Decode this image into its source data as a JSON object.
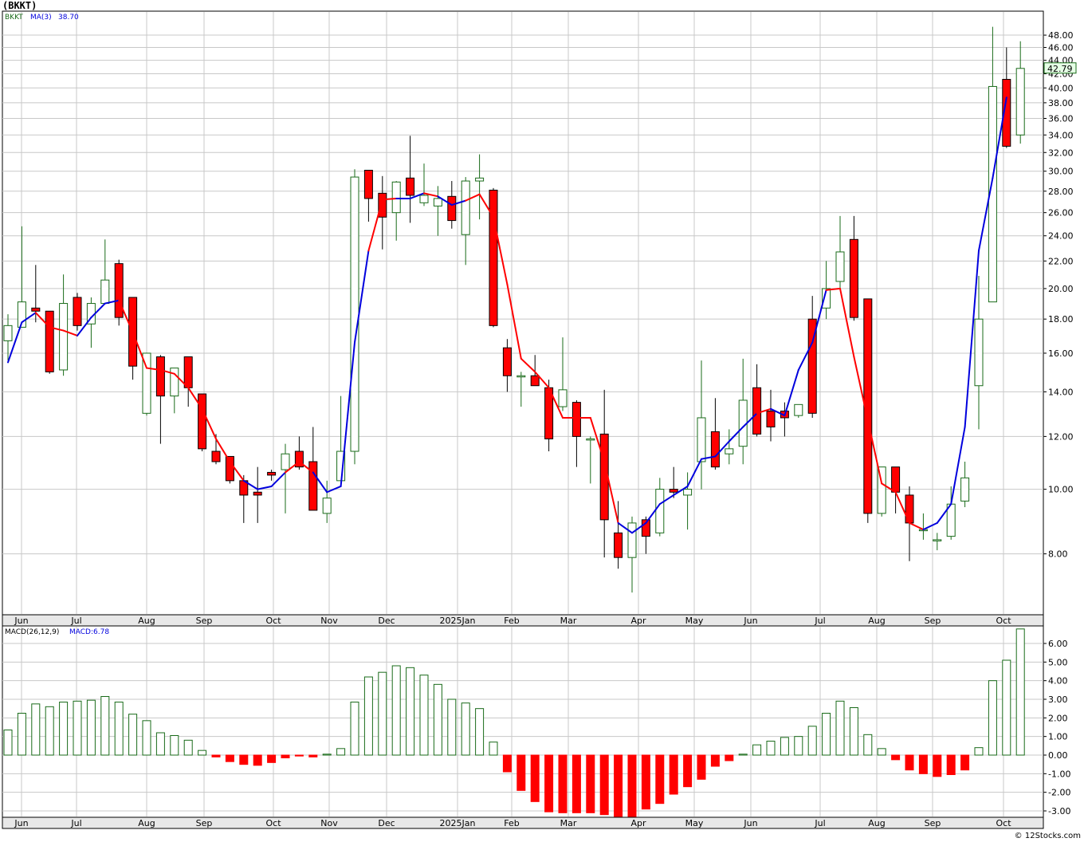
{
  "window": {
    "title": "(BKKT)",
    "footer": "© 12Stocks.com"
  },
  "price_panel": {
    "symbol_label": "BKKT",
    "ma_label": "MA(3)",
    "ma_value": "38.70",
    "last_price": "42.79"
  },
  "macd_panel": {
    "label": "MACD(26,12,9)",
    "value_label": "MACD:6.78"
  },
  "colors": {
    "up_candle": "#1a6b1a",
    "down_candle": "#ff0000",
    "ma_up": "#0000dd",
    "ma_down": "#ff0000",
    "grid": "#c8c8c8",
    "last_price_box": "#e6ffe6"
  },
  "chart_data": [
    {
      "type": "candlestick",
      "scale": "log",
      "ylim": [
        6.5,
        52
      ],
      "y_ticks": [
        "8.00",
        "10.00",
        "12.00",
        "14.00",
        "16.00",
        "18.00",
        "20.00",
        "22.00",
        "24.00",
        "26.00",
        "28.00",
        "30.00",
        "32.00",
        "34.00",
        "36.00",
        "38.00",
        "40.00",
        "42.00",
        "44.00",
        "46.00",
        "48.00"
      ],
      "x_labels": [
        "Jun",
        "Jul",
        "Aug",
        "Sep",
        "Oct",
        "Nov",
        "Dec",
        "2025Jan",
        "Feb",
        "Mar",
        "Apr",
        "May",
        "Jun",
        "Jul",
        "Aug",
        "Sep",
        "Oct"
      ],
      "ohlc": [
        [
          16.7,
          18.3,
          15.6,
          17.6
        ],
        [
          17.5,
          24.8,
          17.5,
          19.1
        ],
        [
          18.7,
          21.7,
          17.8,
          18.5
        ],
        [
          18.5,
          18.5,
          14.9,
          15.0
        ],
        [
          15.1,
          21.0,
          14.8,
          19.0
        ],
        [
          19.4,
          19.7,
          17.3,
          17.6
        ],
        [
          17.7,
          19.4,
          16.3,
          19.0
        ],
        [
          19.0,
          23.7,
          19.0,
          20.6
        ],
        [
          21.8,
          22.1,
          17.6,
          18.1
        ],
        [
          19.4,
          19.4,
          14.6,
          15.3
        ],
        [
          13.0,
          16.0,
          12.9,
          16.0
        ],
        [
          15.8,
          15.9,
          11.7,
          13.8
        ],
        [
          13.8,
          15.2,
          13.0,
          15.2
        ],
        [
          15.8,
          15.8,
          13.3,
          14.2
        ],
        [
          13.9,
          13.9,
          11.4,
          11.5
        ],
        [
          11.4,
          12.1,
          10.9,
          11.0
        ],
        [
          11.2,
          11.2,
          10.2,
          10.3
        ],
        [
          10.3,
          10.5,
          8.9,
          9.8
        ],
        [
          9.9,
          10.8,
          8.9,
          9.8
        ],
        [
          10.6,
          10.7,
          10.3,
          10.5
        ],
        [
          10.7,
          11.7,
          9.2,
          11.3
        ],
        [
          11.4,
          12.0,
          10.7,
          10.8
        ],
        [
          11.0,
          12.4,
          9.3,
          9.3
        ],
        [
          9.2,
          10.3,
          8.9,
          9.7
        ],
        [
          10.3,
          13.8,
          10.3,
          11.4
        ],
        [
          11.4,
          30.2,
          10.9,
          29.4
        ],
        [
          30.1,
          30.1,
          25.2,
          27.3
        ],
        [
          27.8,
          29.5,
          22.9,
          25.6
        ],
        [
          26.0,
          29.0,
          23.6,
          28.9
        ],
        [
          29.3,
          33.9,
          25.1,
          27.6
        ],
        [
          26.9,
          30.8,
          26.6,
          27.6
        ],
        [
          26.6,
          28.5,
          24.0,
          27.3
        ],
        [
          27.5,
          29.0,
          24.6,
          25.3
        ],
        [
          24.1,
          29.4,
          21.7,
          29.0
        ],
        [
          29.0,
          31.8,
          25.4,
          29.3
        ],
        [
          28.1,
          28.3,
          17.5,
          17.6
        ],
        [
          16.3,
          16.8,
          14.0,
          14.8
        ],
        [
          14.8,
          15.0,
          13.3,
          14.8
        ],
        [
          14.8,
          15.9,
          14.6,
          14.3
        ],
        [
          14.2,
          14.6,
          11.4,
          11.9
        ],
        [
          13.3,
          16.9,
          13.1,
          14.1
        ],
        [
          13.5,
          13.6,
          10.8,
          12.0
        ],
        [
          11.9,
          12.0,
          10.2,
          11.9
        ],
        [
          12.1,
          14.1,
          7.9,
          9.0
        ],
        [
          8.6,
          9.6,
          7.6,
          7.9
        ],
        [
          7.9,
          9.1,
          7.0,
          8.9
        ],
        [
          9.0,
          9.1,
          8.0,
          8.5
        ],
        [
          8.6,
          10.4,
          8.5,
          10.0
        ],
        [
          10.0,
          10.8,
          9.7,
          9.9
        ],
        [
          9.8,
          10.6,
          8.7,
          10.0
        ],
        [
          11.0,
          15.6,
          10.0,
          12.8
        ],
        [
          12.2,
          13.7,
          10.7,
          10.8
        ],
        [
          11.3,
          12.3,
          10.9,
          11.5
        ],
        [
          11.6,
          15.7,
          10.9,
          13.6
        ],
        [
          14.2,
          15.4,
          12.0,
          12.1
        ],
        [
          13.1,
          14.1,
          11.8,
          12.4
        ],
        [
          13.1,
          13.5,
          12.0,
          12.8
        ],
        [
          12.9,
          13.4,
          12.8,
          13.4
        ],
        [
          18.0,
          19.5,
          12.8,
          13.0
        ],
        [
          18.7,
          22.0,
          18.0,
          20.0
        ],
        [
          20.5,
          25.7,
          19.9,
          22.7
        ],
        [
          23.7,
          25.7,
          17.9,
          18.1
        ],
        [
          19.3,
          19.3,
          8.9,
          9.2
        ],
        [
          9.2,
          10.5,
          9.1,
          10.8
        ],
        [
          10.8,
          10.8,
          9.2,
          9.9
        ],
        [
          9.8,
          10.1,
          7.8,
          8.9
        ],
        [
          8.7,
          9.2,
          8.4,
          8.7
        ],
        [
          8.4,
          8.6,
          8.1,
          8.4
        ],
        [
          8.5,
          10.1,
          8.4,
          9.5
        ],
        [
          9.6,
          11.0,
          9.4,
          10.4
        ],
        [
          14.3,
          20.9,
          12.3,
          18.0
        ],
        [
          19.1,
          49.4,
          19.1,
          40.2
        ],
        [
          41.2,
          46.0,
          32.5,
          32.7
        ],
        [
          34.0,
          47.0,
          33.0,
          42.79
        ]
      ],
      "ma3": [
        15.5,
        17.8,
        18.4,
        17.5,
        17.3,
        17.0,
        18.1,
        19.0,
        19.2,
        17.2,
        15.2,
        15.1,
        14.9,
        14.2,
        13.2,
        11.9,
        11.0,
        10.3,
        10.0,
        10.1,
        10.6,
        11.0,
        10.6,
        9.9,
        10.1,
        16.6,
        22.8,
        27.2,
        27.3,
        27.3,
        27.8,
        27.5,
        26.7,
        27.1,
        27.7,
        25.6,
        20.3,
        15.7,
        15.0,
        14.2,
        12.8,
        12.8,
        12.8,
        11.0,
        8.9,
        8.6,
        8.9,
        9.5,
        9.8,
        10.1,
        11.1,
        11.2,
        11.8,
        12.4,
        13.0,
        13.2,
        12.9,
        15.1,
        16.6,
        19.9,
        20.0,
        15.8,
        12.7,
        10.2,
        9.9,
        8.9,
        8.7,
        8.9,
        9.5,
        12.4,
        22.8,
        29.3,
        38.7
      ],
      "ma3_dir": [
        "b",
        "b",
        "b",
        "r",
        "r",
        "r",
        "b",
        "b",
        "b",
        "r",
        "r",
        "r",
        "r",
        "r",
        "r",
        "r",
        "r",
        "r",
        "b",
        "b",
        "b",
        "r",
        "r",
        "b",
        "b",
        "b",
        "b",
        "r",
        "r",
        "b",
        "b",
        "r",
        "b",
        "b",
        "r",
        "r",
        "r",
        "r",
        "r",
        "r",
        "r",
        "r",
        "r",
        "r",
        "r",
        "b",
        "b",
        "b",
        "b",
        "b",
        "b",
        "b",
        "b",
        "b",
        "b",
        "r",
        "b",
        "b",
        "b",
        "b",
        "r",
        "r",
        "r",
        "r",
        "r",
        "r",
        "r",
        "b",
        "b",
        "b",
        "b",
        "b",
        "b"
      ]
    },
    {
      "type": "bar",
      "title": "MACD(26,12,9)",
      "ylim": [
        -3.3,
        6.9
      ],
      "y_ticks": [
        "-3.00",
        "-2.00",
        "-1.00",
        "0.00",
        "1.00",
        "2.00",
        "3.00",
        "4.00",
        "5.00",
        "6.00"
      ],
      "x_labels": [
        "Jun",
        "Jul",
        "Aug",
        "Sep",
        "Oct",
        "Nov",
        "Dec",
        "2025Jan",
        "Feb",
        "Mar",
        "Apr",
        "May",
        "Jun",
        "Jul",
        "Aug",
        "Sep",
        "Oct"
      ],
      "values": [
        1.35,
        2.25,
        2.75,
        2.6,
        2.85,
        2.9,
        2.95,
        3.15,
        2.85,
        2.2,
        1.85,
        1.2,
        1.05,
        0.8,
        0.25,
        -0.1,
        -0.35,
        -0.5,
        -0.55,
        -0.4,
        -0.15,
        -0.05,
        -0.1,
        0.05,
        0.35,
        2.85,
        4.2,
        4.45,
        4.8,
        4.7,
        4.3,
        3.8,
        3.0,
        2.8,
        2.5,
        0.7,
        -0.9,
        -1.9,
        -2.5,
        -3.05,
        -3.1,
        -3.1,
        -3.1,
        -3.2,
        -3.3,
        -3.3,
        -2.9,
        -2.6,
        -2.1,
        -1.7,
        -1.3,
        -0.6,
        -0.3,
        0.05,
        0.55,
        0.75,
        0.95,
        1.0,
        1.55,
        2.25,
        2.9,
        2.55,
        1.1,
        0.35,
        -0.25,
        -0.8,
        -1.0,
        -1.15,
        -1.05,
        -0.8,
        0.4,
        4.0,
        5.1,
        6.78
      ]
    }
  ]
}
